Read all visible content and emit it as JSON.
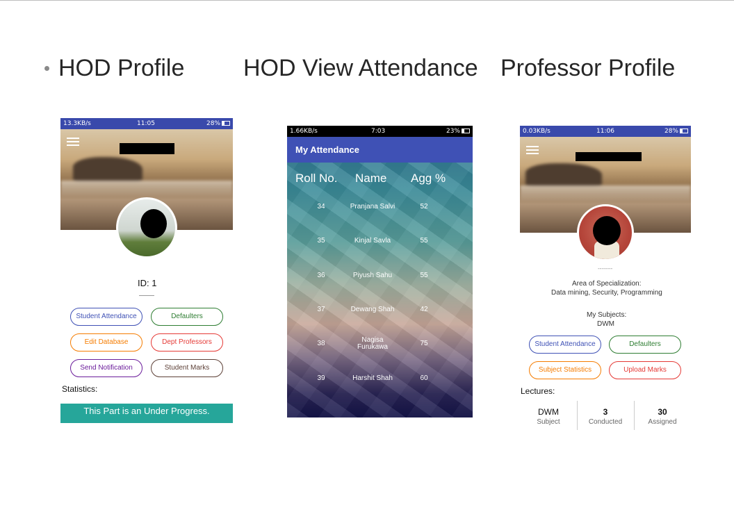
{
  "slide": {
    "titles": [
      "HOD Profile",
      "HOD View Attendance",
      "Professor Profile"
    ]
  },
  "hod_profile": {
    "status": {
      "left": "13.3KB/s",
      "time": "11:05",
      "battery": "28%"
    },
    "id_text": "ID: 1",
    "buttons": [
      {
        "label": "Student Attendance",
        "color": "#3f51b5"
      },
      {
        "label": "Defaulters",
        "color": "#2e7d32"
      },
      {
        "label": "Edit Database",
        "color": "#f57c00"
      },
      {
        "label": "Dept Professors",
        "color": "#e53935"
      },
      {
        "label": "Send Notification",
        "color": "#6a1b9a"
      },
      {
        "label": "Student Marks",
        "color": "#5d4037"
      }
    ],
    "statistics_label": "Statistics:",
    "progress_banner": "This Part is an Under Progress.",
    "banner_color": "#26a69a"
  },
  "attendance": {
    "status": {
      "left": "1.66KB/s",
      "time": "7:03",
      "battery": "23%"
    },
    "app_title": "My Attendance",
    "columns": [
      "Roll No.",
      "Name",
      "Agg %"
    ],
    "rows": [
      {
        "roll": "34",
        "name": "Pranjana Salvi",
        "agg": "52"
      },
      {
        "roll": "35",
        "name": "Kinjal Savla",
        "agg": "55"
      },
      {
        "roll": "36",
        "name": "Piyush Sahu",
        "agg": "55"
      },
      {
        "roll": "37",
        "name": "Dewang Shah",
        "agg": "42"
      },
      {
        "roll": "38",
        "name": "Nagisa Furukawa",
        "agg": "75"
      },
      {
        "roll": "39",
        "name": "Harshit Shah",
        "agg": "60"
      }
    ],
    "bar_color": "#3f51b5"
  },
  "professor_profile": {
    "status": {
      "left": "0.03KB/s",
      "time": "11:06",
      "battery": "28%"
    },
    "dashes": "--------",
    "specialization_label": "Area of Specialization:",
    "specialization_value": "Data mining, Security, Programming",
    "subjects_label": "My Subjects:",
    "subjects_value": "DWM",
    "buttons": [
      {
        "label": "Student Attendance",
        "color": "#3f51b5"
      },
      {
        "label": "Defaulters",
        "color": "#2e7d32"
      },
      {
        "label": "Subject Statistics",
        "color": "#f57c00"
      },
      {
        "label": "Upload Marks",
        "color": "#e53935"
      }
    ],
    "lectures_label": "Lectures:",
    "stats": [
      {
        "value": "DWM",
        "label": "Subject"
      },
      {
        "value": "3",
        "label": "Conducted"
      },
      {
        "value": "30",
        "label": "Assigned"
      }
    ]
  }
}
